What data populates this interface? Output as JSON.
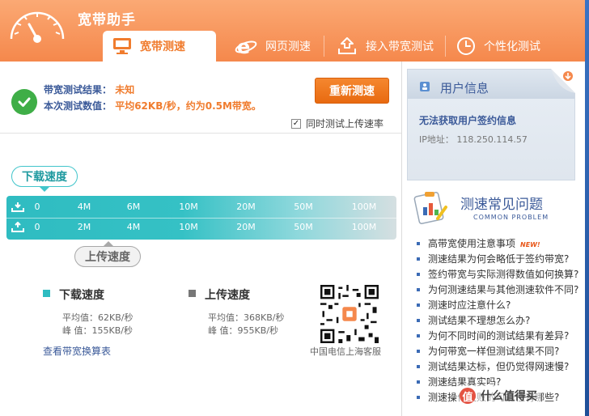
{
  "app": {
    "title": "宽带助手"
  },
  "tabs": [
    {
      "label": "宽带测速",
      "icon": "monitor-icon",
      "active": true
    },
    {
      "label": "网页测速",
      "icon": "browser-e-icon",
      "active": false
    },
    {
      "label": "接入带宽测试",
      "icon": "upload-tray-icon",
      "active": false
    },
    {
      "label": "个性化测试",
      "icon": "clock-icon",
      "active": false
    }
  ],
  "result": {
    "label1": "带宽测试结果：",
    "value1": "未知",
    "label2": "本次测试数值：",
    "value2": "平均62KB/秒，约为0.5M带宽。",
    "retest_label": "重新测速",
    "upload_checkbox_label": "同时测试上传速率",
    "upload_checked": true
  },
  "speedbar": {
    "download_label": "下载速度",
    "upload_label": "上传速度",
    "download_ticks": [
      "0",
      "4M",
      "6M",
      "10M",
      "20M",
      "50M",
      "100M"
    ],
    "upload_ticks": [
      "0",
      "2M",
      "4M",
      "10M",
      "20M",
      "50M",
      "100M"
    ]
  },
  "stats": {
    "download": {
      "title": "下载速度",
      "avg": "平均值：62KB/秒",
      "peak": "峰  值：155KB/秒",
      "color": "#2fbcc1"
    },
    "upload": {
      "title": "上传速度",
      "avg": "平均值：368KB/秒",
      "peak": "峰  值：955KB/秒",
      "color": "#777777"
    },
    "calc_link": "查看带宽换算表"
  },
  "qr": {
    "caption": "中国电信上海客服"
  },
  "user_info": {
    "title": "用户信息",
    "no_info": "无法获取用户签约信息",
    "ip": "IP地址： 118.250.114.57"
  },
  "faq": {
    "title": "测速常见问题",
    "subtitle": "COMMON PROBLEM",
    "new_tag": "NEW!",
    "items": [
      "高带宽使用注意事项",
      "测速结果为何会略低于签约带宽?",
      "签约带宽与实际测得数值如何换算?",
      "为何测速结果与其他测速软件不同?",
      "测速时应注意什么?",
      "测试结果不理想怎么办?",
      "为何不同时间的测试结果有差异?",
      "为何带宽一样但测试结果不同?",
      "测试结果达标，但仍觉得网速慢?",
      "测速结果真实吗?",
      "测速操作失败的可能性有哪些?"
    ]
  },
  "watermark": {
    "badge": "值",
    "text": "什么值得买"
  },
  "colors": {
    "brand_orange": "#f5884c",
    "accent_teal": "#2fbcc1",
    "link_blue": "#3b5a99"
  }
}
